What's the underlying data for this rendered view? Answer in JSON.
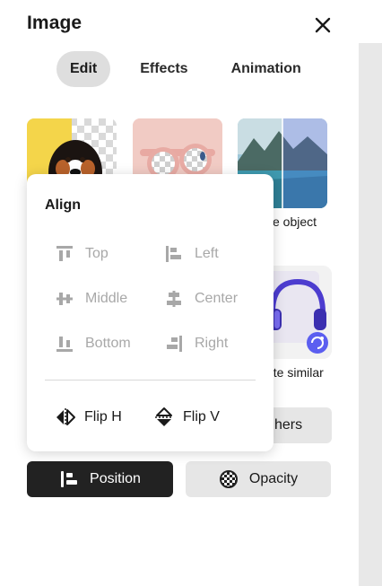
{
  "panel": {
    "title": "Image",
    "tabs": [
      {
        "label": "Edit",
        "active": true
      },
      {
        "label": "Effects",
        "active": false
      },
      {
        "label": "Animation",
        "active": false
      }
    ]
  },
  "quick_actions": {
    "remove_object_label": "ve object",
    "generate_similar_label": "ate similar",
    "partial_button_label": "hers"
  },
  "align_menu": {
    "title": "Align",
    "items": [
      {
        "label": "Top",
        "icon": "align-top-icon"
      },
      {
        "label": "Left",
        "icon": "align-left-icon"
      },
      {
        "label": "Middle",
        "icon": "align-middle-icon"
      },
      {
        "label": "Center",
        "icon": "align-center-icon"
      },
      {
        "label": "Bottom",
        "icon": "align-bottom-icon"
      },
      {
        "label": "Right",
        "icon": "align-right-icon"
      }
    ],
    "flip_h": "Flip H",
    "flip_v": "Flip V"
  },
  "actions": {
    "position_label": "Position",
    "opacity_label": "Opacity"
  },
  "colors": {
    "active_button": "#222222",
    "disabled_text": "#a8a8a8",
    "accent_badge": "#5b5ef0"
  }
}
